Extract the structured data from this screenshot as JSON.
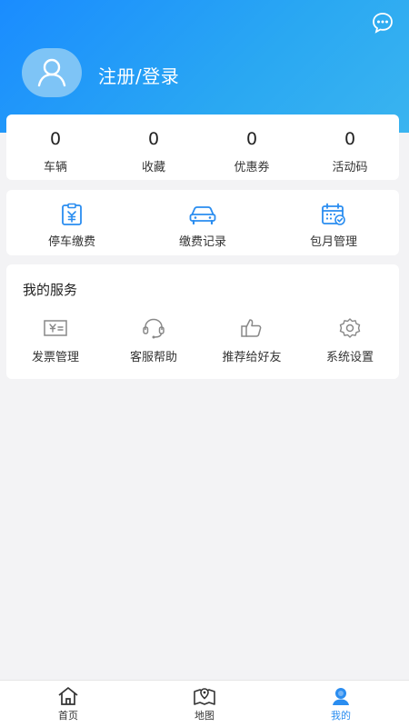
{
  "header": {
    "login_text": "注册/登录",
    "message_icon": "chat-bubble-icon",
    "avatar_icon": "user-avatar-icon"
  },
  "stats": [
    {
      "value": "0",
      "label": "车辆"
    },
    {
      "value": "0",
      "label": "收藏"
    },
    {
      "value": "0",
      "label": "优惠券"
    },
    {
      "value": "0",
      "label": "活动码"
    }
  ],
  "quick_actions": [
    {
      "label": "停车缴费",
      "icon": "parking-payment-icon"
    },
    {
      "label": "缴费记录",
      "icon": "car-icon"
    },
    {
      "label": "包月管理",
      "icon": "calendar-check-icon"
    }
  ],
  "services": {
    "title": "我的服务",
    "items": [
      {
        "label": "发票管理",
        "icon": "invoice-icon"
      },
      {
        "label": "客服帮助",
        "icon": "headset-icon"
      },
      {
        "label": "推荐给好友",
        "icon": "thumbs-up-icon"
      },
      {
        "label": "系统设置",
        "icon": "gear-icon"
      }
    ]
  },
  "tabbar": [
    {
      "label": "首页",
      "icon": "home-icon",
      "active": false
    },
    {
      "label": "地图",
      "icon": "map-icon",
      "active": false
    },
    {
      "label": "我的",
      "icon": "profile-icon",
      "active": true
    }
  ],
  "colors": {
    "primary": "#2a8df0",
    "header_gradient_start": "#1a8cff",
    "header_gradient_end": "#3ab4f0",
    "background": "#f3f3f5"
  }
}
